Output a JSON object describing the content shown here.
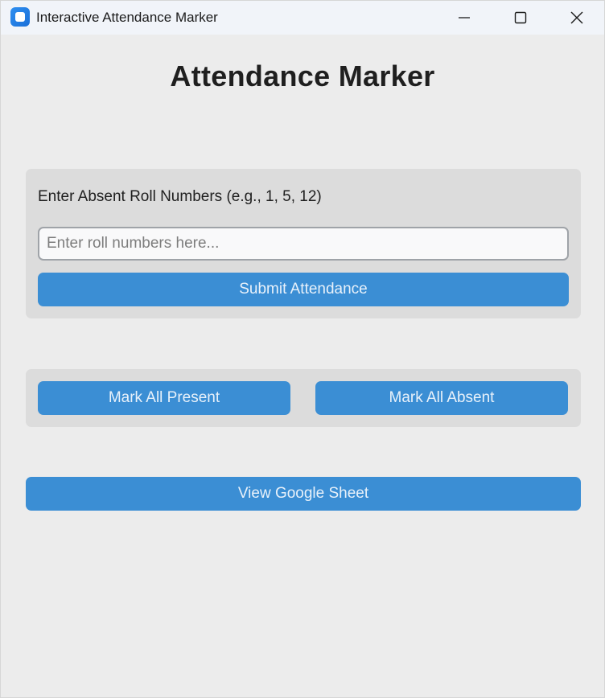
{
  "window": {
    "title": "Interactive Attendance Marker"
  },
  "main": {
    "heading": "Attendance Marker",
    "input_label": "Enter Absent Roll Numbers (e.g., 1, 5, 12)",
    "input_placeholder": "Enter roll numbers here...",
    "input_value": "",
    "submit_label": "Submit Attendance",
    "mark_all_present_label": "Mark All Present",
    "mark_all_absent_label": "Mark All Absent",
    "view_sheet_label": "View Google Sheet"
  },
  "icons": {
    "app": "app-icon",
    "minimize": "minimize-icon",
    "maximize": "maximize-icon",
    "close": "close-icon"
  },
  "colors": {
    "button": "#3b8ed4",
    "button_text": "#e8f1fa",
    "panel": "#dcdcdc",
    "background": "#ececec",
    "titlebar": "#f1f4f9"
  }
}
